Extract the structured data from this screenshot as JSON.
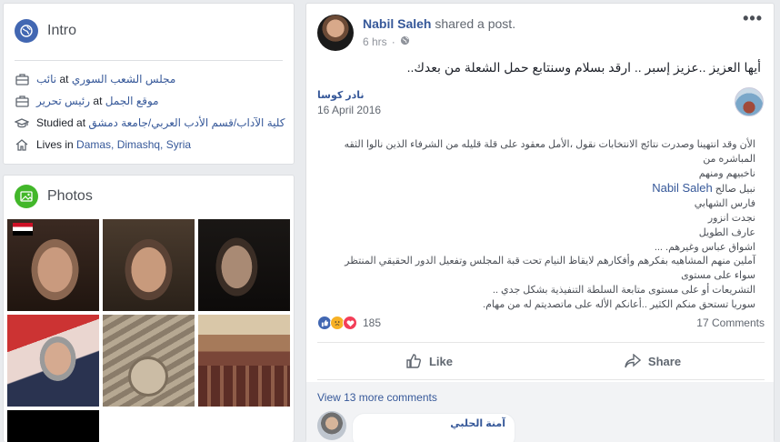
{
  "intro": {
    "title": "Intro",
    "items": [
      {
        "icon": "briefcase-icon",
        "prefix": "",
        "text": "مجلس الشعب السوري",
        "mid": " at ",
        "text2": "نائب"
      },
      {
        "icon": "briefcase-icon",
        "prefix": "",
        "text": "موقع الجمل",
        "mid": " at ",
        "text2": "رئيس تحرير"
      },
      {
        "icon": "graduation-cap-icon",
        "prefix": "Studied at ",
        "text": "كلية الآداب/قسم الأدب العربي/جامعة دمشق"
      },
      {
        "icon": "house-icon",
        "prefix": "Lives in ",
        "text": "Damas, Dimashq, Syria"
      }
    ]
  },
  "photos": {
    "title": "Photos"
  },
  "post": {
    "author": "Nabil Saleh",
    "action": " shared a post.",
    "time": "6 hrs",
    "more": "•••",
    "text": "أيها العزيز ..عزيز إسبر .. ارقد بسلام وسنتابع حمل الشعلة من بعدك..",
    "inner": {
      "name": "نادر كوسا",
      "date": "16 April 2016",
      "lines": [
        "الأن وقد انتهينا وصدرت نتائج الانتخابات نقول ،الأمل معقود على قلة قليله من الشرفاء الذين نالوا الثقه المباشره من",
        "ناخبيهم ومنهم"
      ],
      "tagged": "Nabil Saleh",
      "tag_prefix": "نبيل صالح ",
      "names": [
        "فارس الشهابي",
        "نجدت انزور",
        "عارف الطويل",
        "اشواق عباس وغيرهم. ..."
      ],
      "closing": [
        "آملين منهم المشاهيه بفكرهم وأفكارهم لايقاظ النيام تحت قبة المجلس وتفعيل الدور الحقيقي المنتظر سواء على مستوى",
        "التشريعات أو على مستوى متابعة السلطة التنفيذية بشكل جدي ..",
        "سوريا تستحق منكم الكثير ..أعانكم الأله على ماتصديتم له من مهام."
      ]
    },
    "reactions_count": "185",
    "comments_count": "17 Comments",
    "like_label": "Like",
    "share_label": "Share",
    "view_more": "View 13 more comments",
    "commenter": "آمنة الحلبي"
  },
  "colors": {
    "brand": "#4267b2",
    "link": "#365899",
    "love": "#f33e58",
    "sad": "#f7b125"
  }
}
